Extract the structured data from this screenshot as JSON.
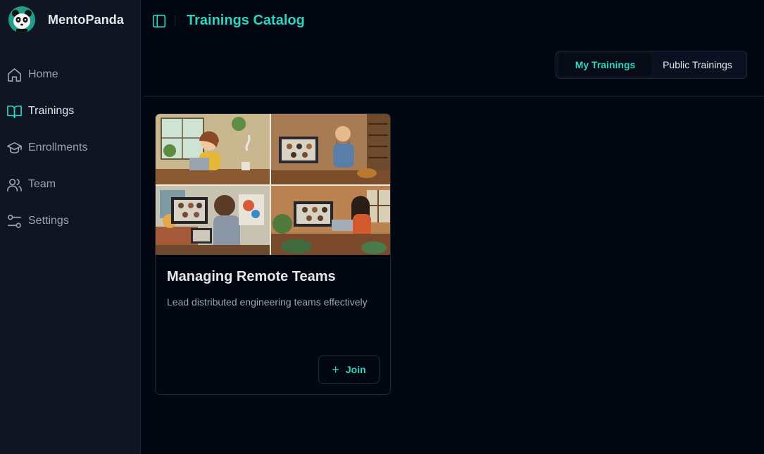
{
  "app": {
    "name": "MentoPanda",
    "logo_icon": "panda-logo-icon"
  },
  "sidebar": {
    "items": [
      {
        "label": "Home",
        "icon": "home-icon",
        "active": false
      },
      {
        "label": "Trainings",
        "icon": "book-open-icon",
        "active": true
      },
      {
        "label": "Enrollments",
        "icon": "graduation-cap-icon",
        "active": false
      },
      {
        "label": "Team",
        "icon": "users-icon",
        "active": false
      },
      {
        "label": "Settings",
        "icon": "sliders-icon",
        "active": false
      }
    ]
  },
  "header": {
    "title": "Trainings Catalog",
    "toggle_icon": "panel-left-icon"
  },
  "tabs": {
    "selected": "My Trainings",
    "items": [
      "My Trainings",
      "Public Trainings"
    ]
  },
  "trainings": [
    {
      "title": "Managing Remote Teams",
      "description": "Lead distributed engineering teams effectively",
      "join_label": "Join"
    }
  ],
  "colors": {
    "accent": "#2dd4bf",
    "background": "#030712",
    "sidebar": "#0f1523",
    "border": "#1f2937"
  }
}
